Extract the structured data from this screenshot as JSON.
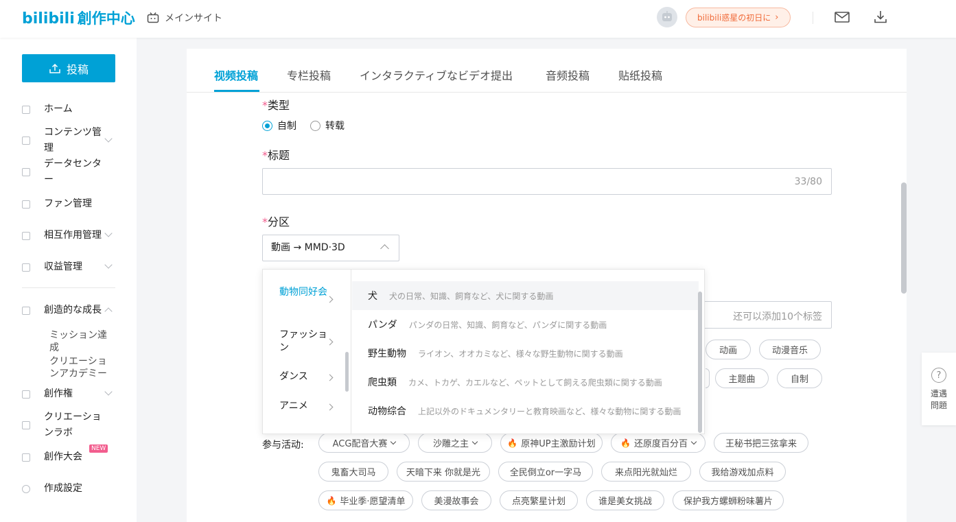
{
  "header": {
    "logo_main": "bilibili",
    "logo_sub": "創作中心",
    "main_site": "メインサイト",
    "promo": "bilibili惑星の初日に",
    "colors": {
      "accent": "#00a1d6",
      "promo_text": "#f06b3a",
      "required": "#f25d8e"
    }
  },
  "sidebar": {
    "upload": "投稿",
    "items": [
      {
        "label": "ホーム",
        "icon": "home-icon"
      },
      {
        "label": "コンテンツ管理",
        "icon": "content-icon"
      },
      {
        "label": "データセンター",
        "icon": "data-icon"
      },
      {
        "label": "ファン管理",
        "icon": "fans-icon"
      },
      {
        "label": "相互作用管理",
        "icon": "interaction-icon"
      },
      {
        "label": "収益管理",
        "icon": "revenue-icon"
      },
      {
        "label": "創造的な成長",
        "icon": "growth-icon"
      },
      {
        "label": "創作権",
        "icon": "rights-icon"
      },
      {
        "label": "クリエーションラボ",
        "icon": "lab-icon"
      },
      {
        "label": "創作大会",
        "icon": "contest-icon",
        "badge": "NEW"
      },
      {
        "label": "作成設定",
        "icon": "settings-icon"
      }
    ],
    "sub_items": [
      "ミッション達成",
      "クリエーションアカデミー"
    ]
  },
  "tabs": [
    "视频投稿",
    "专栏投稿",
    "インタラクティブなビデオ提出",
    "音频投稿",
    "贴纸投稿"
  ],
  "form": {
    "required_mark": "*",
    "type_label": "类型",
    "type_options": [
      "自制",
      "转载"
    ],
    "type_selected": "自制",
    "title_label": "标题",
    "title_value": "",
    "title_counter": "33/80",
    "category_label": "分区",
    "category_value": "動画 → MMD·3D",
    "tag_hint": "还可以添加10个标签",
    "tag_chips_row1": [
      "动画",
      "动漫音乐"
    ],
    "tag_chips_row2": [
      "主题曲",
      "自制"
    ],
    "activity_label": "参与活动:",
    "activities": [
      {
        "label": "ACG配音大赛",
        "dropdown": true,
        "hot": false
      },
      {
        "label": "沙雕之主",
        "dropdown": true,
        "hot": false
      },
      {
        "label": "原神UP主激励计划",
        "dropdown": false,
        "hot": true
      },
      {
        "label": "还原度百分百",
        "dropdown": true,
        "hot": true
      },
      {
        "label": "王秘书把三弦拿来",
        "dropdown": false,
        "hot": false
      },
      {
        "label": "鬼畜大司马",
        "dropdown": false,
        "hot": false
      },
      {
        "label": "天暗下来 你就是光",
        "dropdown": false,
        "hot": false
      },
      {
        "label": "全民倒立or一字马",
        "dropdown": false,
        "hot": false
      },
      {
        "label": "来点阳光就灿烂",
        "dropdown": false,
        "hot": false
      },
      {
        "label": "我给游戏加点料",
        "dropdown": false,
        "hot": false
      },
      {
        "label": "毕业季·愿望清单",
        "dropdown": false,
        "hot": true
      },
      {
        "label": "美漫故事会",
        "dropdown": false,
        "hot": false
      },
      {
        "label": "点亮繁星计划",
        "dropdown": false,
        "hot": false
      },
      {
        "label": "谁是美女挑战",
        "dropdown": false,
        "hot": false
      },
      {
        "label": "保护我方螺蛳粉味薯片",
        "dropdown": false,
        "hot": false
      }
    ]
  },
  "category_dropdown": {
    "left": [
      {
        "label": "動物同好会",
        "active": true
      },
      {
        "label": "ファッション",
        "active": false
      },
      {
        "label": "ダンス",
        "active": false
      },
      {
        "label": "アニメ",
        "active": false
      }
    ],
    "right": [
      {
        "name": "犬",
        "desc": "犬の日常、知識、飼育など、犬に関する動画",
        "hover": true
      },
      {
        "name": "パンダ",
        "desc": "パンダの日常、知識、飼育など、パンダに関する動画",
        "hover": false
      },
      {
        "name": "野生動物",
        "desc": "ライオン、オオカミなど、様々な野生動物に関する動画",
        "hover": false
      },
      {
        "name": "爬虫類",
        "desc": "カメ、トカゲ、カエルなど、ペットとして飼える爬虫類に関する動画",
        "hover": false
      },
      {
        "name": "动物综合",
        "desc": "上記以外のドキュメンタリーと教育映画など、様々な動物に関する動画",
        "hover": false
      }
    ]
  },
  "help": {
    "label": "遭遇問題",
    "symbol": "?"
  }
}
